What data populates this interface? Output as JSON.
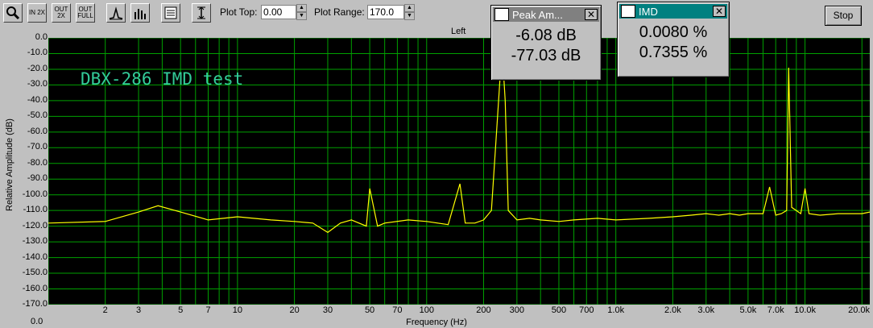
{
  "toolbar": {
    "buttons": [
      "zoom-in",
      "zoom-in-2x",
      "zoom-out-2x",
      "zoom-out-full",
      "spectrum-view",
      "bar-view",
      "options",
      "autoscale"
    ],
    "zoom_in_2x_label": "IN 2X",
    "zoom_out_2x_label": "OUT 2X",
    "zoom_out_full_label": "OUT FULL",
    "plot_top_label": "Plot Top:",
    "plot_top_value": "0.00",
    "plot_range_label": "Plot Range:",
    "plot_range_value": "170.0",
    "stop_label": "Stop"
  },
  "channel_label": "Left",
  "plot": {
    "y_ticks": [
      "0.0",
      "-10.0",
      "-20.0",
      "-30.0",
      "-40.0",
      "-50.0",
      "-60.0",
      "-70.0",
      "-80.0",
      "-90.0",
      "-100.0",
      "-110.0",
      "-120.0",
      "-130.0",
      "-140.0",
      "-150.0",
      "-160.0",
      "-170.0"
    ],
    "x_ticks": [
      {
        "label": "2",
        "hz": 2
      },
      {
        "label": "3",
        "hz": 3
      },
      {
        "label": "5",
        "hz": 5
      },
      {
        "label": "7",
        "hz": 7
      },
      {
        "label": "10",
        "hz": 10
      },
      {
        "label": "20",
        "hz": 20
      },
      {
        "label": "30",
        "hz": 30
      },
      {
        "label": "50",
        "hz": 50
      },
      {
        "label": "70",
        "hz": 70
      },
      {
        "label": "100",
        "hz": 100
      },
      {
        "label": "200",
        "hz": 200
      },
      {
        "label": "300",
        "hz": 300
      },
      {
        "label": "500",
        "hz": 500
      },
      {
        "label": "700",
        "hz": 700
      },
      {
        "label": "1.0k",
        "hz": 1000
      },
      {
        "label": "2.0k",
        "hz": 2000
      },
      {
        "label": "3.0k",
        "hz": 3000
      },
      {
        "label": "5.0k",
        "hz": 5000
      },
      {
        "label": "7.0k",
        "hz": 7000
      },
      {
        "label": "10.0k",
        "hz": 10000
      },
      {
        "label": "20.0k",
        "hz": 20000
      }
    ],
    "ylabel": "Relative Amplitude (dB)",
    "xlabel": "Frequency (Hz)",
    "annotation": "DBX-286 IMD test",
    "bottom_left": "0.0"
  },
  "peak_window": {
    "title": "Peak Am...",
    "line1": "-6.08 dB",
    "line2": "-77.03 dB"
  },
  "imd_window": {
    "title": "IMD",
    "line1": "0.0080 %",
    "line2": "0.7355 %"
  },
  "colors": {
    "trace": "#ffff00",
    "grid": "#00a000",
    "background": "#000000",
    "annotation": "#33cc99"
  },
  "chart_data": {
    "type": "line",
    "xscale": "log",
    "xlim": [
      1,
      22000
    ],
    "ylim": [
      -170,
      0
    ],
    "grid": true,
    "annotation": "DBX-286 IMD test",
    "xlabel": "Frequency (Hz)",
    "ylabel": "Relative Amplitude (dB)",
    "series": [
      {
        "x": [
          1,
          2,
          3,
          3.8,
          5,
          7,
          10,
          15,
          20,
          25,
          30,
          35,
          40,
          48,
          50,
          55,
          60,
          80,
          100,
          130,
          150,
          160,
          180,
          200,
          220,
          240,
          250,
          260,
          270,
          300,
          350,
          400,
          500,
          600,
          800,
          1000,
          1500,
          2000,
          2500,
          3000,
          3500,
          4000,
          4500,
          5000,
          6000,
          6500,
          7000,
          7500,
          8000,
          8200,
          8500,
          9000,
          9500,
          10000,
          10500,
          12000,
          15000,
          20000,
          22000
        ],
        "y": [
          -118,
          -117,
          -111,
          -107,
          -111,
          -116,
          -114,
          -116,
          -117,
          -118,
          -124,
          -118,
          -116,
          -120,
          -96,
          -120,
          -118,
          -116,
          -117,
          -119,
          -93,
          -118,
          -118,
          -116,
          -110,
          -40,
          -6,
          -40,
          -110,
          -116,
          -115,
          -116,
          -117,
          -116,
          -115,
          -116,
          -115,
          -114,
          -113,
          -112,
          -113,
          -112,
          -113,
          -112,
          -112,
          -95,
          -113,
          -112,
          -110,
          -19,
          -108,
          -110,
          -112,
          -96,
          -112,
          -113,
          -112,
          -112,
          -111
        ]
      }
    ]
  }
}
